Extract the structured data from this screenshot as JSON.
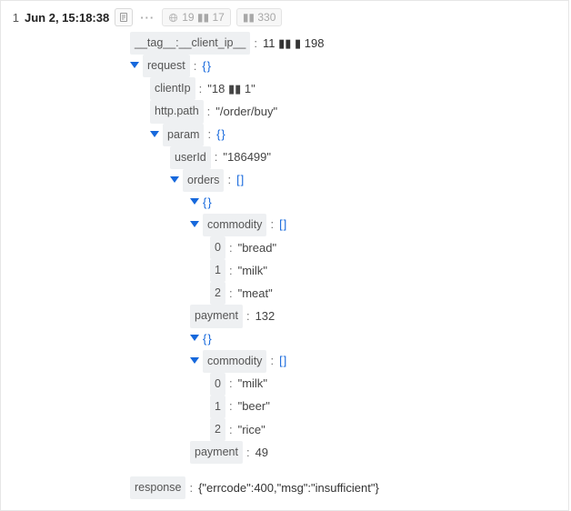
{
  "rownum": "1",
  "timestamp": "Jun 2, 15:18:38",
  "header_ip_a": "19",
  "header_ip_b": "17",
  "header_ip_c": "330",
  "tag_key": "__tag__:__client_ip__",
  "tag_val_prefix": "11",
  "tag_val_suffix": "198",
  "k_request": "request",
  "k_clientIp": "clientIp",
  "v_clientIp_a": "18",
  "v_clientIp_b": "1",
  "k_httppath": "http.path",
  "v_httppath": "/order/buy",
  "k_param": "param",
  "k_userId": "userId",
  "v_userId": "186499",
  "k_orders": "orders",
  "k_commodity": "commodity",
  "k_payment": "payment",
  "idx0": "0",
  "idx1": "1",
  "idx2": "2",
  "o1c0": "bread",
  "o1c1": "milk",
  "o1c2": "meat",
  "o1pay": "132",
  "o2c0": "milk",
  "o2c1": "beer",
  "o2c2": "rice",
  "o2pay": "49",
  "k_response": "response",
  "v_response": "{\"errcode\":400,\"msg\":\"insufficient\"}",
  "brace_obj": "{}",
  "brace_arr": "[]",
  "chart_data": null
}
